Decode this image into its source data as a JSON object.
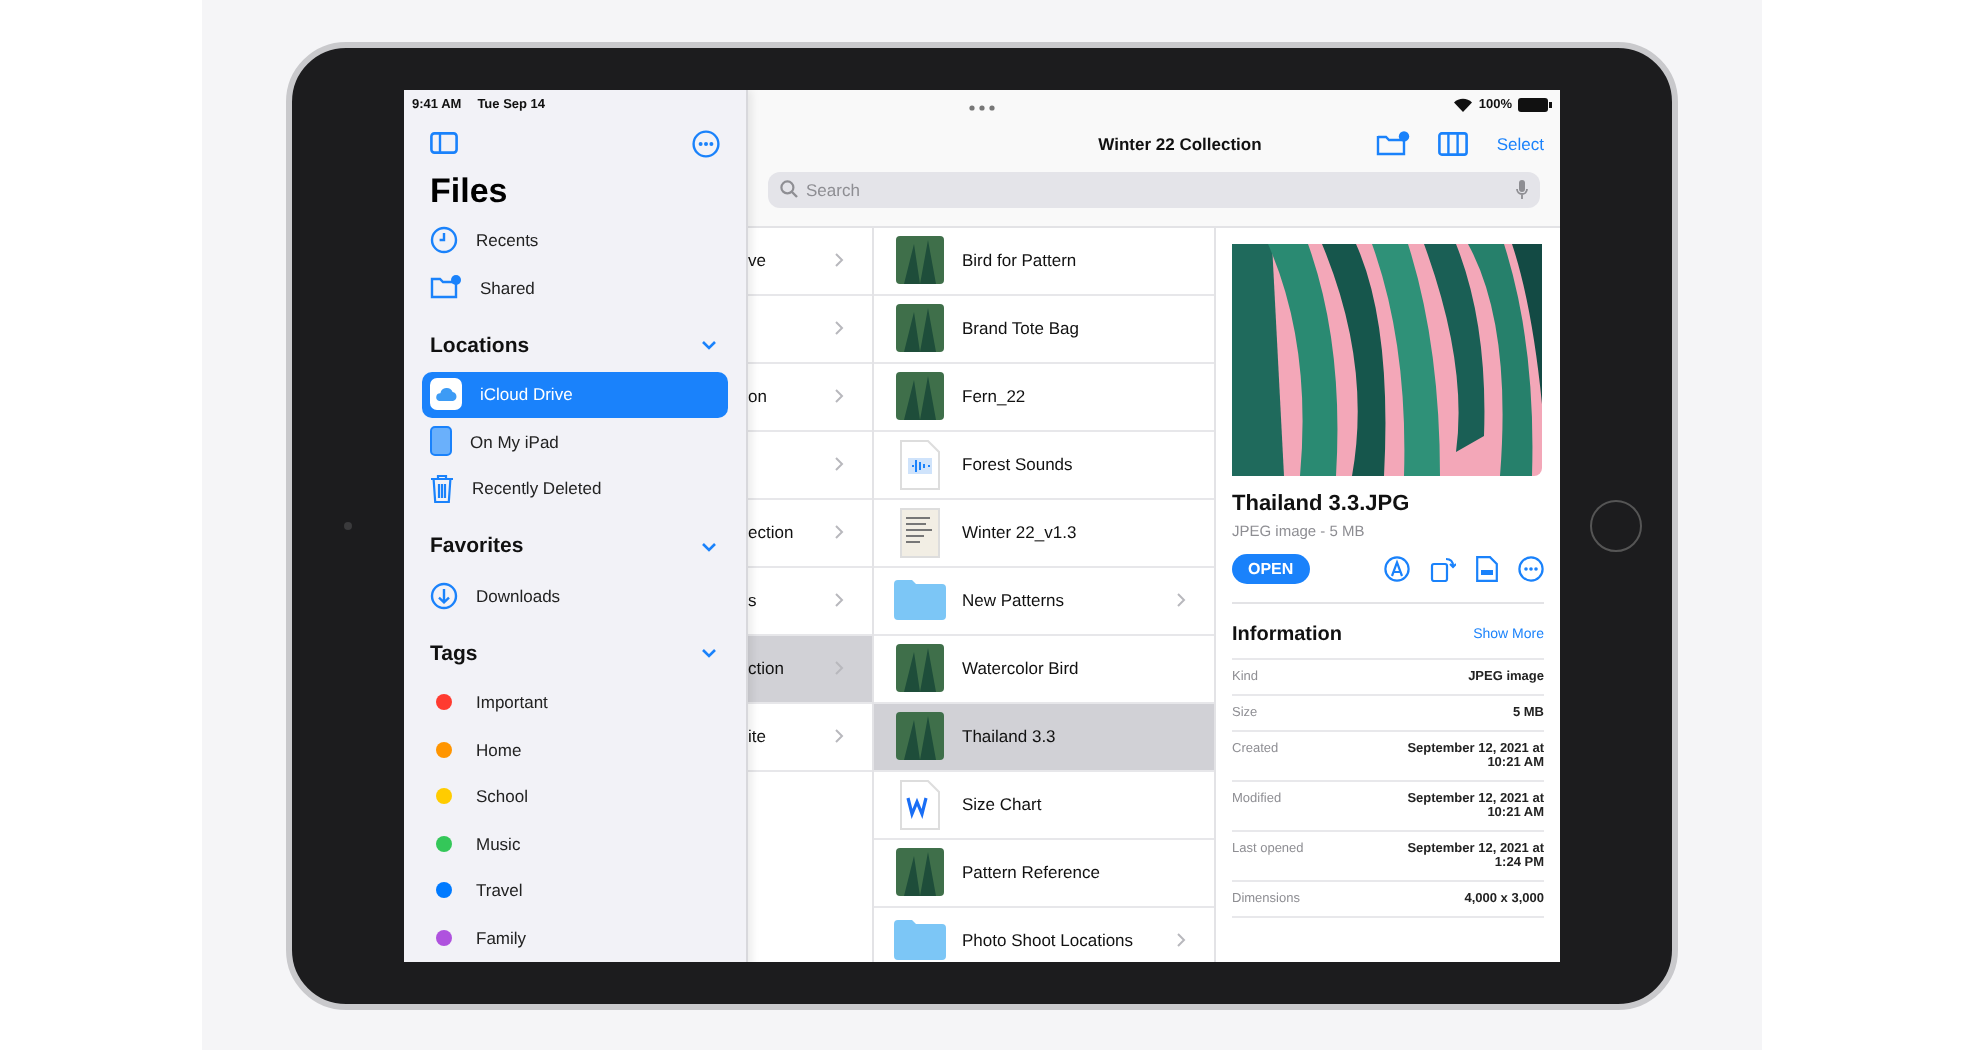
{
  "status_bar": {
    "time": "9:41 AM",
    "date": "Tue Sep 14",
    "battery": "100%"
  },
  "sidebar": {
    "title": "Files",
    "items": [
      {
        "label": "Recents",
        "kind": "recents",
        "selected": false
      },
      {
        "label": "Shared",
        "kind": "shared",
        "selected": false
      }
    ],
    "sections": [
      {
        "title": "Locations",
        "expanded": true,
        "items": [
          {
            "label": "iCloud Drive",
            "kind": "icloud",
            "selected": true
          },
          {
            "label": "On My iPad",
            "kind": "ipad",
            "selected": false
          },
          {
            "label": "Recently Deleted",
            "kind": "trash",
            "selected": false
          }
        ]
      },
      {
        "title": "Favorites",
        "expanded": true,
        "items": [
          {
            "label": "Downloads",
            "kind": "download",
            "selected": false
          }
        ]
      },
      {
        "title": "Tags",
        "expanded": true,
        "items": [
          {
            "label": "Important",
            "kind": "tag",
            "color": "#ff3b30",
            "selected": false
          },
          {
            "label": "Home",
            "kind": "tag",
            "color": "#ff9500",
            "selected": false
          },
          {
            "label": "School",
            "kind": "tag",
            "color": "#ffcc00",
            "selected": false
          },
          {
            "label": "Music",
            "kind": "tag",
            "color": "#34c759",
            "selected": false
          },
          {
            "label": "Travel",
            "kind": "tag",
            "color": "#007aff",
            "selected": false
          },
          {
            "label": "Family",
            "kind": "tag",
            "color": "#af52de",
            "selected": false
          }
        ]
      }
    ]
  },
  "toolbar": {
    "title": "Winter 22 Collection",
    "select": "Select"
  },
  "search": {
    "placeholder": "Search"
  },
  "column_1": {
    "rows": [
      {
        "label": "ve",
        "selected": false
      },
      {
        "selected": false
      },
      {
        "label": "on",
        "selected": false
      },
      {
        "selected": false
      },
      {
        "label": "ection",
        "selected": false
      },
      {
        "label": "s",
        "selected": false
      },
      {
        "label": "ction",
        "selected": true
      },
      {
        "label": "ite",
        "selected": false
      }
    ]
  },
  "column_2": {
    "rows": [
      {
        "name": "Bird for Pattern",
        "kind": "image",
        "selected": false
      },
      {
        "name": "Brand Tote Bag",
        "kind": "image",
        "selected": false
      },
      {
        "name": "Fern_22",
        "kind": "image",
        "selected": false
      },
      {
        "name": "Forest Sounds",
        "kind": "audio",
        "selected": false
      },
      {
        "name": "Winter 22_v1.3",
        "kind": "document",
        "selected": false
      },
      {
        "name": "New Patterns",
        "kind": "folder",
        "selected": false
      },
      {
        "name": "Watercolor Bird",
        "kind": "image",
        "selected": false
      },
      {
        "name": "Thailand 3.3",
        "kind": "image",
        "selected": true
      },
      {
        "name": "Size Chart",
        "kind": "word",
        "selected": false
      },
      {
        "name": "Pattern Reference",
        "kind": "image",
        "selected": false
      },
      {
        "name": "Photo Shoot Locations",
        "kind": "folder",
        "selected": false
      }
    ]
  },
  "detail": {
    "name": "Thailand 3.3.JPG",
    "subtitle": "JPEG image - 5 MB",
    "open": "OPEN",
    "info_title": "Information",
    "show_more": "Show More",
    "rows": [
      {
        "label": "Kind",
        "value": "JPEG image"
      },
      {
        "label": "Size",
        "value": "5 MB"
      },
      {
        "label": "Created",
        "value": "September 12, 2021 at 10:21 AM"
      },
      {
        "label": "Modified",
        "value": "September 12, 2021 at 10:21 AM"
      },
      {
        "label": "Last opened",
        "value": "September 12, 2021 at 1:24 PM"
      },
      {
        "label": "Dimensions",
        "value": "4,000 x 3,000"
      }
    ]
  }
}
